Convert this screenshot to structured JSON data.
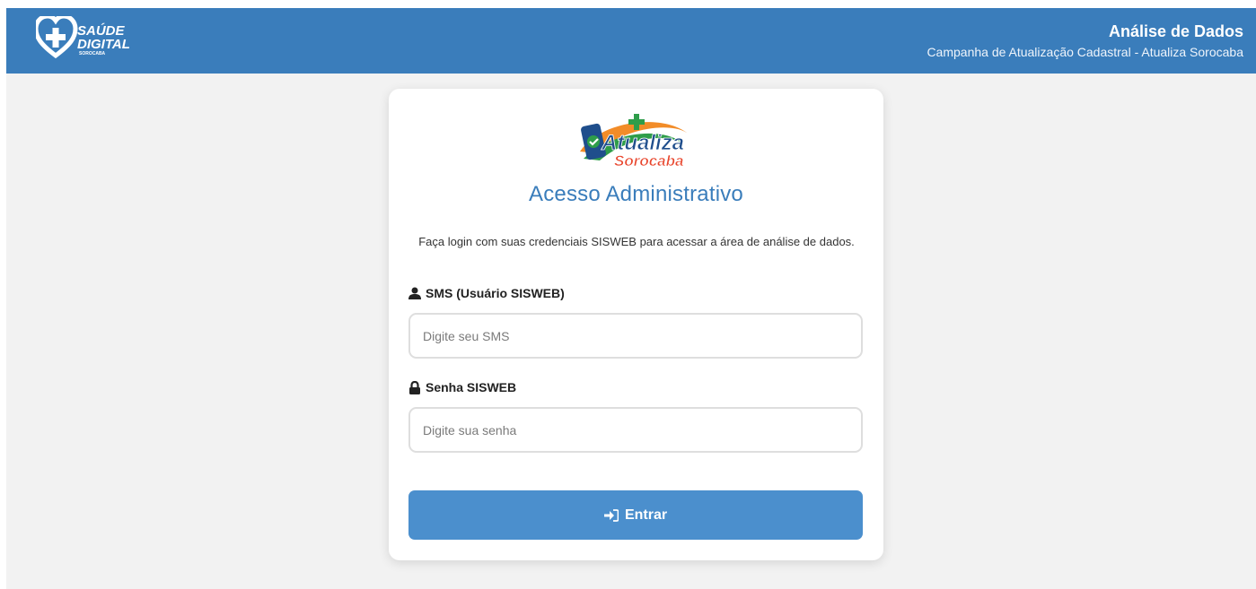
{
  "header": {
    "logo": {
      "line1": "SAÚDE",
      "line2": "DIGITAL",
      "line3": "SOROCABA"
    },
    "title": "Análise de Dados",
    "subtitle": "Campanha de Atualização Cadastral - Atualiza Sorocaba"
  },
  "login": {
    "logo": {
      "line1": "Atualiza",
      "line2": "Sorocaba"
    },
    "title": "Acesso Administrativo",
    "description": "Faça login com suas credenciais SISWEB para acessar a área de análise de dados.",
    "sms_label": "SMS (Usuário SISWEB)",
    "sms_placeholder": "Digite seu SMS",
    "password_label": "Senha SISWEB",
    "password_placeholder": "Digite sua senha",
    "submit_label": "Entrar"
  },
  "colors": {
    "header_bg": "#3a7dbb",
    "title": "#3a7dbb",
    "button_bg": "#4b8fcd",
    "page_bg": "#f2f2f2"
  },
  "icons": {
    "brand": "heart-plus-icon",
    "sms": "user-icon",
    "password": "lock-icon",
    "submit": "sign-in-icon"
  }
}
